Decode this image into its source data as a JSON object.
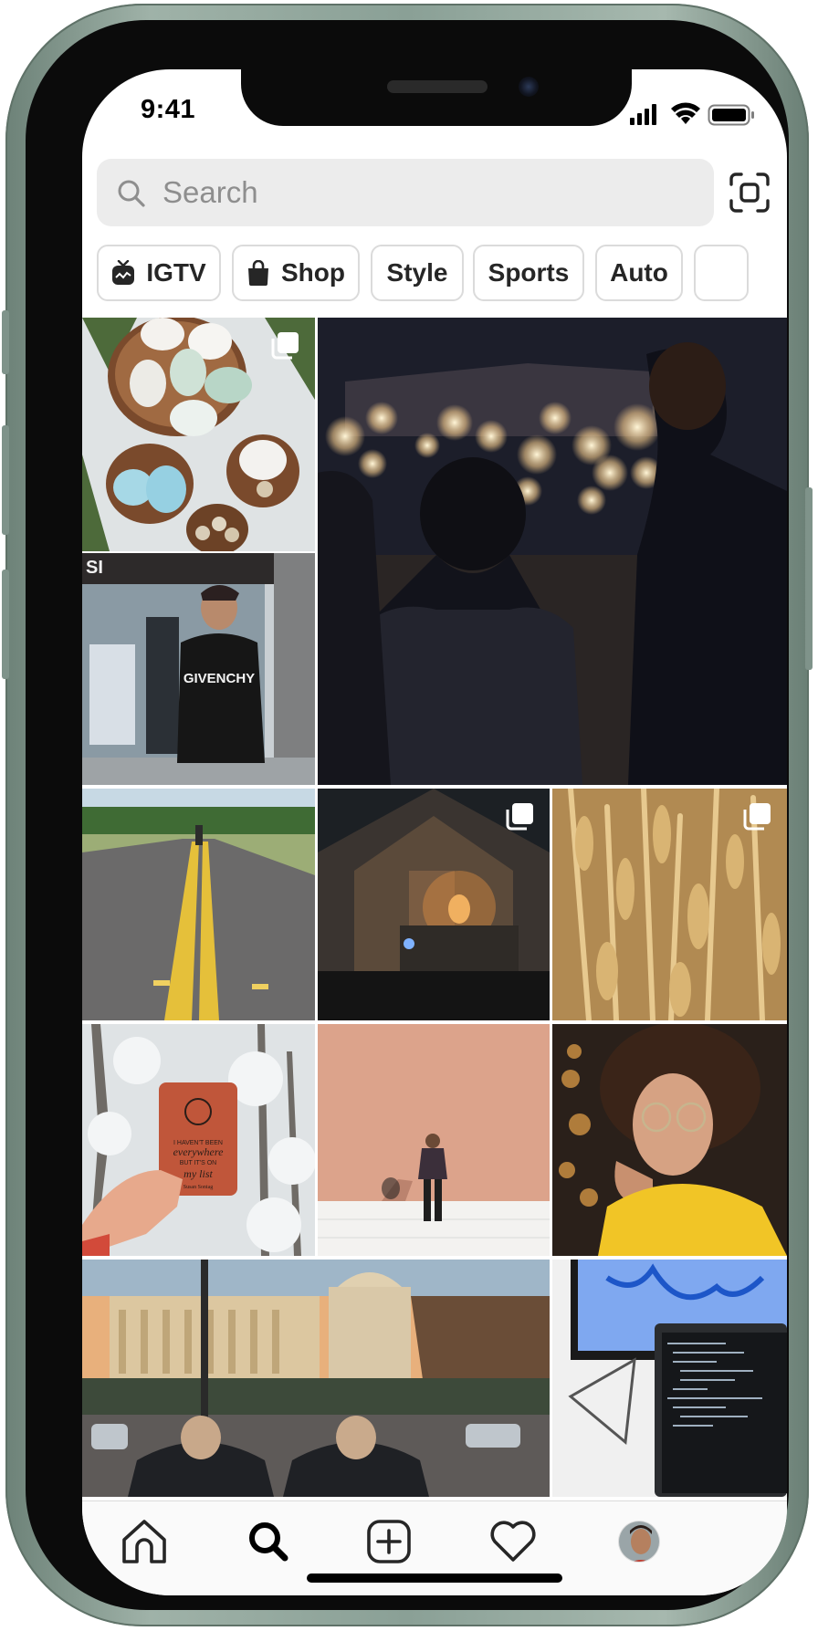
{
  "status_bar": {
    "time": "9:41",
    "icons": [
      "cellular-signal-icon",
      "wifi-icon",
      "battery-icon"
    ]
  },
  "search": {
    "placeholder": "Search",
    "icon": "search-icon",
    "scan_icon": "scan-icon"
  },
  "categories": [
    {
      "label": "IGTV",
      "icon": "igtv-icon"
    },
    {
      "label": "Shop",
      "icon": "shopping-bag-icon"
    },
    {
      "label": "Style"
    },
    {
      "label": "Sports"
    },
    {
      "label": "Auto"
    }
  ],
  "grid": {
    "tiles": [
      {
        "subject": "eggs in wooden bowls",
        "multi": true
      },
      {
        "subject": "couple among sparklers at wedding",
        "multi": false,
        "wide": true
      },
      {
        "subject": "man in GIVENCHY sweatshirt by storefront",
        "multi": false,
        "text": "GIVENCHY"
      },
      {
        "subject": "person walking on country road",
        "multi": false
      },
      {
        "subject": "glowing tent interior at night",
        "multi": true
      },
      {
        "subject": "wheat field close-up",
        "multi": true
      },
      {
        "subject": "hand holding red notebook in snowy forest",
        "multi": false,
        "text": [
          "I HAVEN'T BEEN",
          "everywhere",
          "BUT IT'S ON",
          "my list",
          "Susan Sontag"
        ]
      },
      {
        "subject": "man standing before peach wall",
        "multi": false
      },
      {
        "subject": "woman with curly hair and round glasses",
        "multi": false
      },
      {
        "subject": "capitol building at sunset with crowd",
        "multi": false
      },
      {
        "subject": "laptop with code and blue paint art",
        "multi": false
      }
    ]
  },
  "tab_bar": {
    "tabs": [
      {
        "name": "home",
        "icon": "home-icon"
      },
      {
        "name": "search",
        "icon": "search-icon",
        "active": true
      },
      {
        "name": "new-post",
        "icon": "add-post-icon"
      },
      {
        "name": "activity",
        "icon": "heart-icon"
      },
      {
        "name": "profile",
        "icon": "profile-avatar"
      }
    ]
  },
  "colors": {
    "frame": "#8aa096",
    "accent_text": "#262626",
    "placeholder": "#8e8e8e",
    "chip_border": "#dbdbdb"
  }
}
